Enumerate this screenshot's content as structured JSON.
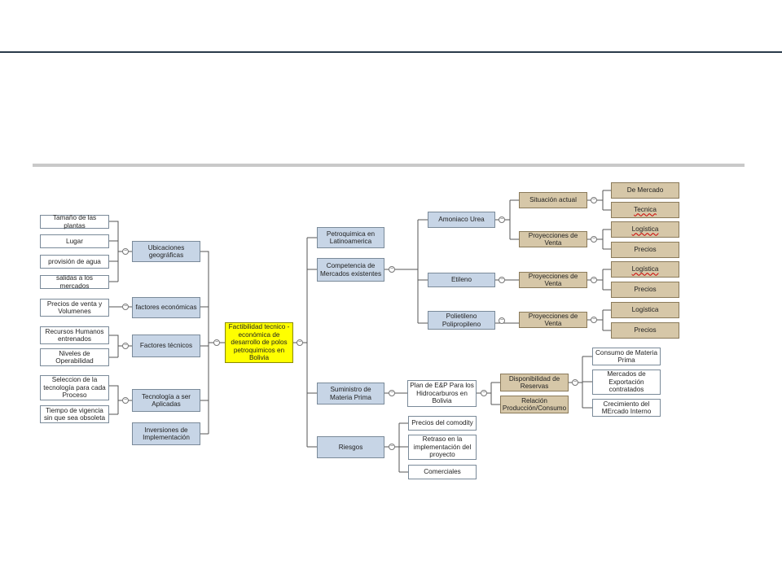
{
  "root": "Factibilidad tecnico - económica de desarrollo de polos petroquimicos  en Bolivia",
  "toggle_symbol": "−",
  "left": {
    "ubicaciones": {
      "label": "Ubicaciones geográficas",
      "children": [
        "Tamaño de las plantas",
        "Lugar",
        "provisión de agua",
        "salidas a los mercados"
      ]
    },
    "factores_economicos": {
      "label": "factores económicas",
      "children": [
        "Precios de venta y Volumenes"
      ]
    },
    "factores_tecnicos": {
      "label": "Factores técnicos",
      "children": [
        "Recursos Humanos entrenados",
        "Niveles de Operabilidad"
      ]
    },
    "tecnologia": {
      "label": "Tecnología a ser Aplicadas",
      "children": [
        "Seleccion de la tecnología para cada Proceso",
        "Tiempo de vigencia sin que sea obsoleta"
      ]
    },
    "inversiones": {
      "label": "Inversiones de Implementación"
    }
  },
  "right": {
    "petroquimica": "Petroquimica en Latinoamerica",
    "competencia": {
      "label": "Competencia de Mercados existentes",
      "amoniaco": {
        "label": "Amoniaco Urea",
        "situacion": {
          "label": "Situación actual",
          "children": [
            "De Mercado",
            "Tecnica"
          ]
        },
        "proyecciones": {
          "label": "Proyecciones de Venta",
          "children": [
            "Logística",
            "Precios"
          ]
        }
      },
      "etileno": {
        "label": "Etileno",
        "proyecciones": {
          "label": "Proyecciones de Venta",
          "children": [
            "Logística",
            "Precios"
          ]
        }
      },
      "polietileno": {
        "label": "Polietileno Polipropileno",
        "proyecciones": {
          "label": "Proyecciones de Venta",
          "children": [
            "Logística",
            "Precios"
          ]
        }
      }
    },
    "suministro": {
      "label": "Suministro de Materia Prima",
      "plan": "Plan de E&P  Para los Hidrocarburos en Bolivia",
      "disponibilidad": {
        "label": "Disponibilidad de Reservas",
        "children": [
          "Consumo de Materia Prima",
          "Mercados de Exportación contratados",
          "Crecimiento del MErcado Interno"
        ]
      },
      "relacion": "Relación Producción/Consumo"
    },
    "riesgos": {
      "label": "Riesgos",
      "children": [
        "Precios del comodity",
        "Retraso en la implementación del proyecto",
        "Comerciales"
      ]
    }
  }
}
